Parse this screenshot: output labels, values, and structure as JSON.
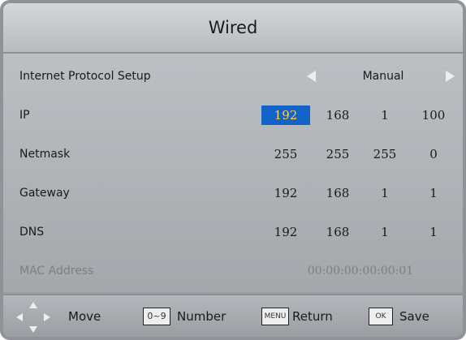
{
  "title": "Wired",
  "rows": {
    "protocol": {
      "label": "Internet Protocol Setup",
      "value": "Manual"
    },
    "ip": {
      "label": "IP",
      "values": [
        "192",
        "168",
        "1",
        "100"
      ]
    },
    "netmask": {
      "label": "Netmask",
      "values": [
        "255",
        "255",
        "255",
        "0"
      ]
    },
    "gateway": {
      "label": "Gateway",
      "values": [
        "192",
        "168",
        "1",
        "1"
      ]
    },
    "dns": {
      "label": "DNS",
      "values": [
        "192",
        "168",
        "1",
        "1"
      ]
    },
    "mac": {
      "label": "MAC Address",
      "value": "00:00:00:00:00:01"
    }
  },
  "footer": {
    "move_label": "Move",
    "number_key": "0~9",
    "number_label": "Number",
    "menu_key": "MENU",
    "return_label": "Return",
    "ok_key": "OK",
    "save_label": "Save"
  },
  "colors": {
    "selected_bg": "#1263c7",
    "selected_text": "#ffd34d"
  }
}
